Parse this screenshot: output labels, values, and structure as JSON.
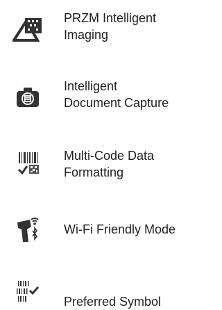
{
  "features": [
    {
      "label": "PRZM Intelligent\nImaging",
      "icon": "prism-triangle-icon"
    },
    {
      "label": "Intelligent\nDocument Capture",
      "icon": "document-camera-icon"
    },
    {
      "label": "Multi-Code Data\nFormatting",
      "icon": "multi-barcode-check-icon"
    },
    {
      "label": "Wi-Fi Friendly Mode",
      "icon": "scanner-wifi-icon"
    },
    {
      "label": "Preferred Symbol",
      "icon": "barcode-list-check-icon"
    }
  ],
  "colors": {
    "icon": "#333333",
    "text": "#1f1f1f",
    "background": "#ffffff"
  }
}
